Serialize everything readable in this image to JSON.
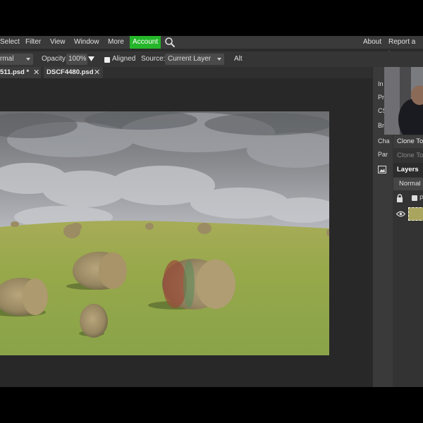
{
  "menubar": {
    "items": [
      "Select",
      "Filter",
      "View",
      "Window",
      "More",
      "Account"
    ],
    "right": [
      "About",
      "Report a bu"
    ]
  },
  "options": {
    "blend_mode": "rmal",
    "opacity_label": "Opacity:",
    "opacity_value": "100%",
    "aligned_label": "Aligned",
    "source_label": "Source:",
    "source_value": "Current Layer",
    "alt_label": "Alt"
  },
  "tabs": [
    {
      "label": "511.psd *"
    },
    {
      "label": "DSCF4480.psd"
    }
  ],
  "toolstrip": {
    "labels": [
      "In",
      "Pr",
      "CS",
      "Br",
      "Cha",
      "Par"
    ]
  },
  "right_panel": {
    "clone_tool_title": "Clone To",
    "clone_tool_sub": "Clone To",
    "layers_tab": "Layers",
    "layer_blend": "Normal",
    "lock_label": "P"
  },
  "colors": {
    "accent_account": "#25b62a",
    "app_bg": "#2b2b2b",
    "menubar_bg": "#3a3a3a"
  }
}
